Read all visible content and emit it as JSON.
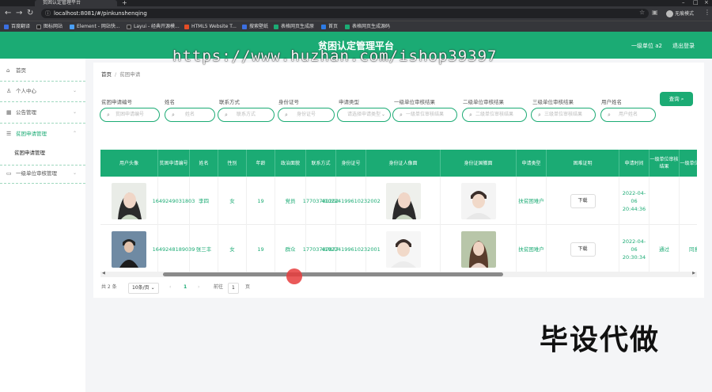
{
  "browser": {
    "tab_title": "贫困认定管理平台",
    "url": "localhost:8081/#/pinkunshenqing",
    "profile_label": "无痕模式",
    "bookmarks": [
      "百度翻译",
      "图标网站",
      "Element - 网站快...",
      "Layui - 经典开源模...",
      "HTML5 Website T...",
      "搜索壁纸",
      "表格网页生成原",
      "首页",
      "表格网页生成源码"
    ]
  },
  "header": {
    "title": "贫困认定管理平台",
    "user": "一级单位 a2",
    "logout": "退出登录"
  },
  "watermark_url": "https://www.huzhan.com/ishop39397",
  "watermark_big": "毕设代做",
  "sidebar": {
    "items": [
      {
        "label": "首页",
        "icon": "home-icon"
      },
      {
        "label": "个人中心",
        "icon": "user-icon"
      },
      {
        "label": "公告管理",
        "icon": "grid-icon"
      },
      {
        "label": "贫困申请管理",
        "icon": "list-icon"
      },
      {
        "label": "一级单位审核管理",
        "icon": "doc-icon"
      }
    ],
    "sub_item": "贫困申请管理"
  },
  "breadcrumb": {
    "home": "首页",
    "sep": "/",
    "current": "贫困申请"
  },
  "filters": [
    {
      "label": "贫困申请编号",
      "placeholder": "贫困申请编号"
    },
    {
      "label": "姓名",
      "placeholder": "姓名"
    },
    {
      "label": "联系方式",
      "placeholder": "联系方式"
    },
    {
      "label": "身份证号",
      "placeholder": "身份证号"
    },
    {
      "label": "申请类型",
      "placeholder": "请选择申请类型"
    },
    {
      "label": "一级单位审核结果",
      "placeholder": "一级单位审核结果"
    },
    {
      "label": "二级单位审核结果",
      "placeholder": "二级单位审核结果"
    },
    {
      "label": "三级单位审核结果",
      "placeholder": "三级单位审核结果"
    },
    {
      "label": "用户姓名",
      "placeholder": "用户姓名"
    }
  ],
  "search_button": "查询",
  "table": {
    "headers": [
      "用户头像",
      "贫困申请编号",
      "姓名",
      "性别",
      "年龄",
      "政治面貌",
      "联系方式",
      "身份证号",
      "身份证人像面",
      "身份证国徽面",
      "申请类型",
      "困难证明",
      "申请时间",
      "一级单位审核结果",
      "一级单位审核"
    ],
    "rows": [
      {
        "id": "1649249031803",
        "name": "李四",
        "gender": "女",
        "age": "19",
        "political": "党员",
        "phone": "17703781202",
        "idcard": "410224199610232002",
        "type": "扶贫困难户",
        "download": "下载",
        "time": "2022-04-06 20:44:36",
        "r1": "",
        "r1b": ""
      },
      {
        "id": "1649248189039",
        "name": "张三丰",
        "gender": "女",
        "age": "19",
        "political": "群众",
        "phone": "17703787877",
        "idcard": "410224199610232001",
        "type": "扶贫困难户",
        "download": "下载",
        "time": "2022-04-06 20:30:34",
        "r1": "通过",
        "r1b": "同意"
      }
    ]
  },
  "pager": {
    "total": "共 2 条",
    "size": "10条/页",
    "page": "1",
    "goto": "前往",
    "goto_val": "1",
    "unit": "页"
  }
}
